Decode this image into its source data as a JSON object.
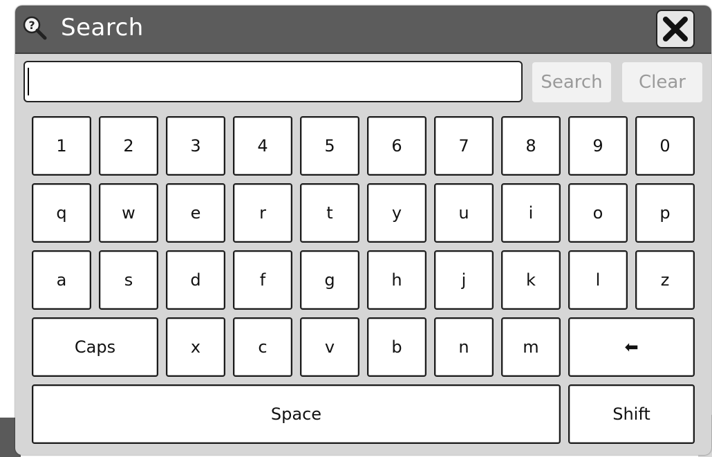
{
  "dialog": {
    "title": "Search",
    "title_icon": "search-help-icon",
    "close_icon": "close-icon"
  },
  "search": {
    "value": "",
    "placeholder": "",
    "search_button_label": "Search",
    "clear_button_label": "Clear"
  },
  "keyboard": {
    "row1": [
      "1",
      "2",
      "3",
      "4",
      "5",
      "6",
      "7",
      "8",
      "9",
      "0"
    ],
    "row2": [
      "q",
      "w",
      "e",
      "r",
      "t",
      "y",
      "u",
      "i",
      "o",
      "p"
    ],
    "row3": [
      "a",
      "s",
      "d",
      "f",
      "g",
      "h",
      "j",
      "k",
      "l",
      "z"
    ],
    "caps_label": "Caps",
    "row4": [
      "x",
      "c",
      "v",
      "b",
      "n",
      "m"
    ],
    "backspace_label": "⬅",
    "space_label": "Space",
    "shift_label": "Shift"
  },
  "colors": {
    "titlebar": "#5c5c5c",
    "dialog_bg": "#d6d6d6",
    "key_bg": "#ffffff",
    "button_text_disabled": "#9a9a9a"
  }
}
